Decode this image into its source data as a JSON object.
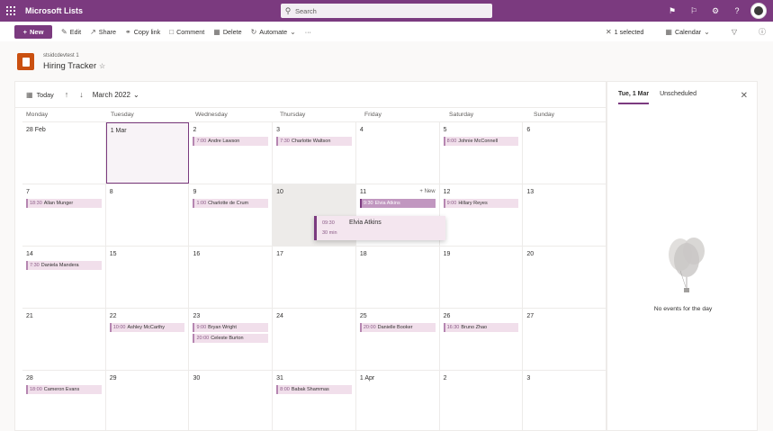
{
  "suite": {
    "app_title": "Microsoft Lists",
    "search_placeholder": "Search"
  },
  "commands": {
    "new": "New",
    "edit": "Edit",
    "share": "Share",
    "copy_link": "Copy link",
    "comment": "Comment",
    "delete": "Delete",
    "automate": "Automate",
    "more": "···",
    "selected": "1 selected",
    "view": "Calendar"
  },
  "list": {
    "site": "stsidcdevtest 1",
    "name": "Hiring Tracker"
  },
  "calendar": {
    "today_label": "Today",
    "month": "March 2022",
    "days": [
      "Monday",
      "Tuesday",
      "Wednesday",
      "Thursday",
      "Friday",
      "Saturday",
      "Sunday"
    ],
    "new_label": "+ New",
    "weeks": [
      {
        "cells": [
          {
            "d": "28 Feb",
            "events": []
          },
          {
            "d": "1 Mar",
            "events": []
          },
          {
            "d": "2",
            "events": [
              {
                "time": "7:00",
                "name": "Andre Lawson"
              }
            ]
          },
          {
            "d": "3",
            "events": [
              {
                "time": "7:30",
                "name": "Charlotte Waltson"
              }
            ]
          },
          {
            "d": "4",
            "events": []
          },
          {
            "d": "5",
            "events": [
              {
                "time": "8:00",
                "name": "Johnie McConnell"
              }
            ]
          },
          {
            "d": "6",
            "events": []
          }
        ]
      },
      {
        "cells": [
          {
            "d": "7",
            "events": [
              {
                "time": "18:30",
                "name": "Allan Munger"
              }
            ]
          },
          {
            "d": "8",
            "events": []
          },
          {
            "d": "9",
            "events": [
              {
                "time": "1:00",
                "name": "Charlotte de Crum"
              }
            ]
          },
          {
            "d": "10",
            "events": []
          },
          {
            "d": "11",
            "events": [
              {
                "time": "9:30",
                "name": "Elvia Atkins"
              }
            ]
          },
          {
            "d": "12",
            "events": [
              {
                "time": "9:00",
                "name": "Hillary Reyes"
              }
            ]
          },
          {
            "d": "13",
            "events": []
          }
        ]
      },
      {
        "cells": [
          {
            "d": "14",
            "events": [
              {
                "time": "7:30",
                "name": "Daniela Mandera"
              }
            ]
          },
          {
            "d": "15",
            "events": []
          },
          {
            "d": "16",
            "events": []
          },
          {
            "d": "17",
            "events": []
          },
          {
            "d": "18",
            "events": []
          },
          {
            "d": "19",
            "events": []
          },
          {
            "d": "20",
            "events": []
          }
        ]
      },
      {
        "cells": [
          {
            "d": "21",
            "events": []
          },
          {
            "d": "22",
            "events": [
              {
                "time": "10:00",
                "name": "Ashley McCarthy"
              }
            ]
          },
          {
            "d": "23",
            "events": [
              {
                "time": "9:00",
                "name": "Bryan Wright"
              },
              {
                "time": "20:00",
                "name": "Celeste Burton"
              }
            ]
          },
          {
            "d": "24",
            "events": []
          },
          {
            "d": "25",
            "events": [
              {
                "time": "20:00",
                "name": "Danielle Booker"
              }
            ]
          },
          {
            "d": "26",
            "events": [
              {
                "time": "16:30",
                "name": "Bruno Zhao"
              }
            ]
          },
          {
            "d": "27",
            "events": []
          }
        ]
      },
      {
        "cells": [
          {
            "d": "28",
            "events": [
              {
                "time": "18:00",
                "name": "Cameron Evans"
              }
            ]
          },
          {
            "d": "29",
            "events": []
          },
          {
            "d": "30",
            "events": []
          },
          {
            "d": "31",
            "events": [
              {
                "time": "8:00",
                "name": "Babak Shammas"
              }
            ]
          },
          {
            "d": "1 Apr",
            "events": []
          },
          {
            "d": "2",
            "events": []
          },
          {
            "d": "3",
            "events": []
          }
        ]
      }
    ],
    "drag_preview": {
      "time": "09:30",
      "duration": "30 min",
      "name": "Elvia Atkins"
    }
  },
  "side_panel": {
    "tab_day": "Tue, 1 Mar",
    "tab_unscheduled": "Unscheduled",
    "empty_message": "No events for the day"
  },
  "colors": {
    "brand": "#7b3a7f",
    "event_bg": "#f1dfeb",
    "event_highlight": "#c197c0"
  }
}
